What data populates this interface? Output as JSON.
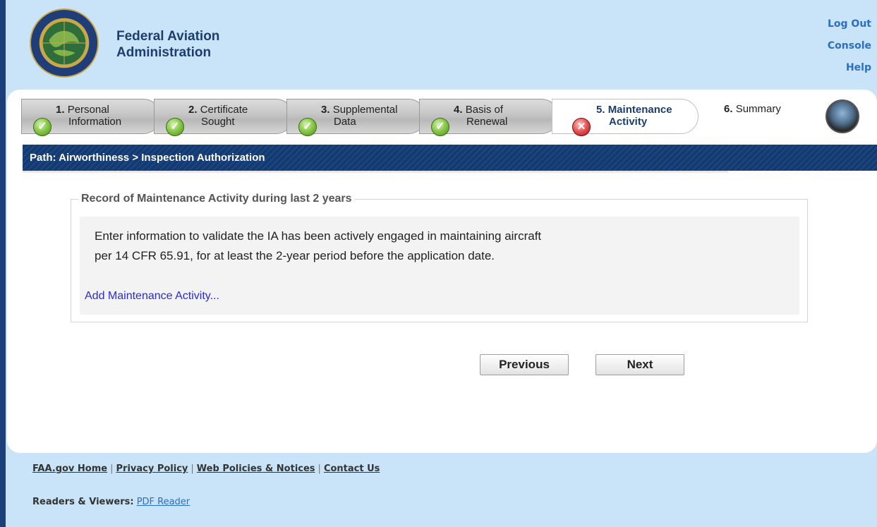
{
  "header": {
    "agency_line1": "Federal Aviation",
    "agency_line2": "Administration",
    "links": {
      "logout": "Log Out",
      "console": "Console",
      "help": "Help"
    }
  },
  "steps": [
    {
      "num": "1.",
      "line1": "Personal",
      "line2": "Information",
      "status": "complete"
    },
    {
      "num": "2.",
      "line1": "Certificate",
      "line2": "Sought",
      "status": "complete"
    },
    {
      "num": "3.",
      "line1": "Supplemental",
      "line2": "Data",
      "status": "complete"
    },
    {
      "num": "4.",
      "line1": "Basis of",
      "line2": "Renewal",
      "status": "complete"
    },
    {
      "num": "5.",
      "line1": "Maintenance",
      "line2": "Activity",
      "status": "error"
    },
    {
      "num": "6.",
      "line1": "Summary",
      "line2": "",
      "status": "pending"
    }
  ],
  "path": {
    "label": "Path:",
    "crumb1": "Airworthiness",
    "sep": ">",
    "crumb2": "Inspection Authorization"
  },
  "section": {
    "legend": "Record of Maintenance Activity during last 2 years",
    "desc_line1": "Enter information to validate the IA has been actively engaged in maintaining aircraft",
    "desc_line2": "per 14 CFR 65.91, for at least the 2-year period before the application date.",
    "add_link": "Add Maintenance Activity..."
  },
  "buttons": {
    "previous": "Previous",
    "next": "Next"
  },
  "footer": {
    "links": [
      "FAA.gov Home",
      "Privacy Policy",
      "Web Policies & Notices",
      "Contact Us"
    ],
    "separator": "|",
    "readers_label": "Readers & Viewers:",
    "pdf_reader": "PDF Reader"
  },
  "colors": {
    "background": "#c9e4f8",
    "path_bar": "#123a73",
    "link": "#2a6fc3",
    "complete": "#8bc94a",
    "error": "#e35151"
  }
}
